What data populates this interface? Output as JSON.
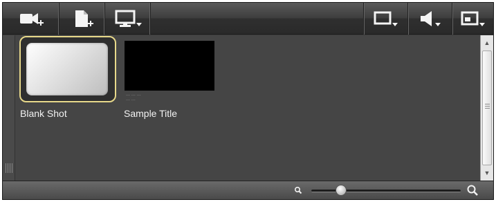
{
  "toolbar": {
    "left_buttons": [
      {
        "name": "add-video-button",
        "icon": "video-camera-plus-icon"
      },
      {
        "name": "add-file-button",
        "icon": "document-plus-icon"
      },
      {
        "name": "display-menu-button",
        "icon": "monitor-dropdown-icon"
      }
    ],
    "right_buttons": [
      {
        "name": "aspect-ratio-button",
        "icon": "frame-dropdown-icon"
      },
      {
        "name": "audio-button",
        "icon": "speaker-dropdown-icon"
      },
      {
        "name": "view-mode-button",
        "icon": "window-dropdown-icon"
      }
    ]
  },
  "clips": [
    {
      "label": "Blank Shot",
      "selected": true,
      "thumbnail": "white-gradient"
    },
    {
      "label": "Sample Title",
      "selected": false,
      "thumbnail": "black",
      "subtext": [
        "… … …",
        "… …"
      ]
    }
  ],
  "zoom": {
    "level": 0.2,
    "small_icon": "zoom-out-icon",
    "large_icon": "zoom-in-icon"
  },
  "colors": {
    "panel_bg": "#454545",
    "selection_border": "#e8d98a",
    "label_text": "#f2f2f2"
  }
}
